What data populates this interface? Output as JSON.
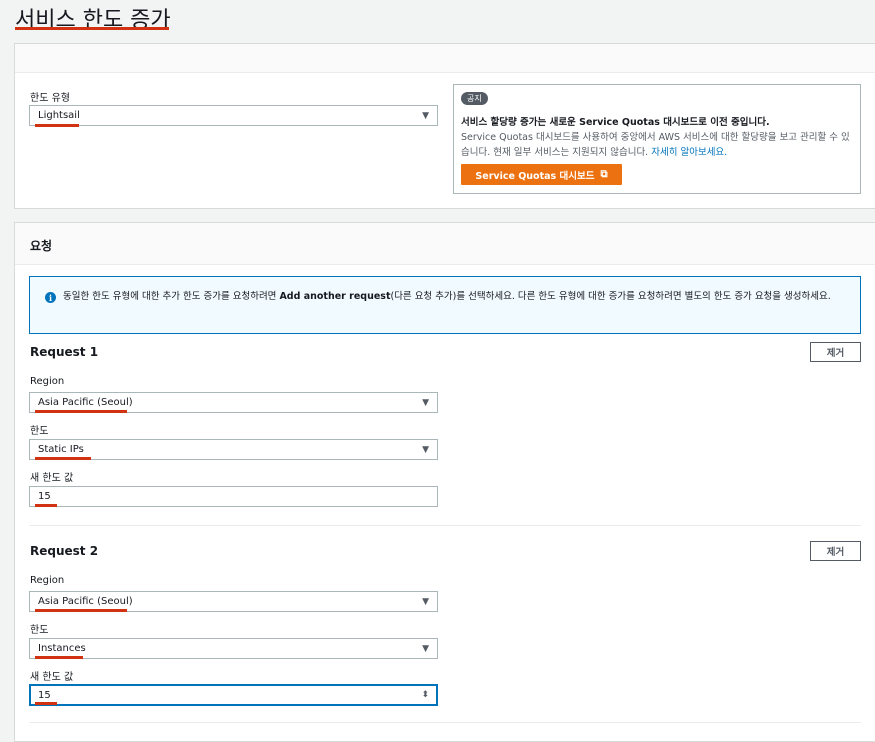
{
  "page": {
    "title": "서비스 한도 증가"
  },
  "top_panel": {
    "limit_type_label": "한도 유형",
    "limit_type_value": "Lightsail"
  },
  "notice": {
    "badge": "공지",
    "title": "서비스 할당량 증가는 새로운 Service Quotas 대시보드로 이전 중입니다.",
    "body": "Service Quotas 대시보드를 사용하여 중앙에서 AWS 서비스에 대한 할당량을 보고 관리할 수 있습니다. 현재 일부 서비스는 지원되지 않습니다.",
    "link": "자세히 알아보세요.",
    "button": "Service Quotas 대시보드"
  },
  "requests_panel": {
    "title": "요청",
    "info_prefix": "동일한 한도 유형에 대한 추가 한도 증가를 요청하려면 ",
    "info_bold": "Add another request",
    "info_suffix": "(다른 요청 추가)를 선택하세요. 다른 한도 유형에 대한 증가를 요청하려면 별도의 한도 증가 요청을 생성하세요.",
    "requests": [
      {
        "title": "Request 1",
        "remove": "제거",
        "region_label": "Region",
        "region_value": "Asia Pacific (Seoul)",
        "limit_label": "한도",
        "limit_value": "Static IPs",
        "new_value_label": "새 한도 값",
        "new_value": "15"
      },
      {
        "title": "Request 2",
        "remove": "제거",
        "region_label": "Region",
        "region_value": "Asia Pacific (Seoul)",
        "limit_label": "한도",
        "limit_value": "Instances",
        "new_value_label": "새 한도 값",
        "new_value": "15"
      }
    ]
  },
  "colors": {
    "accent_orange": "#ec7211",
    "info_blue": "#0073bb",
    "highlight_red": "#d13212"
  },
  "icons": {
    "caret": "caret-down-icon",
    "external": "external-link-icon",
    "info": "info-icon",
    "stepper": "stepper-icon"
  }
}
